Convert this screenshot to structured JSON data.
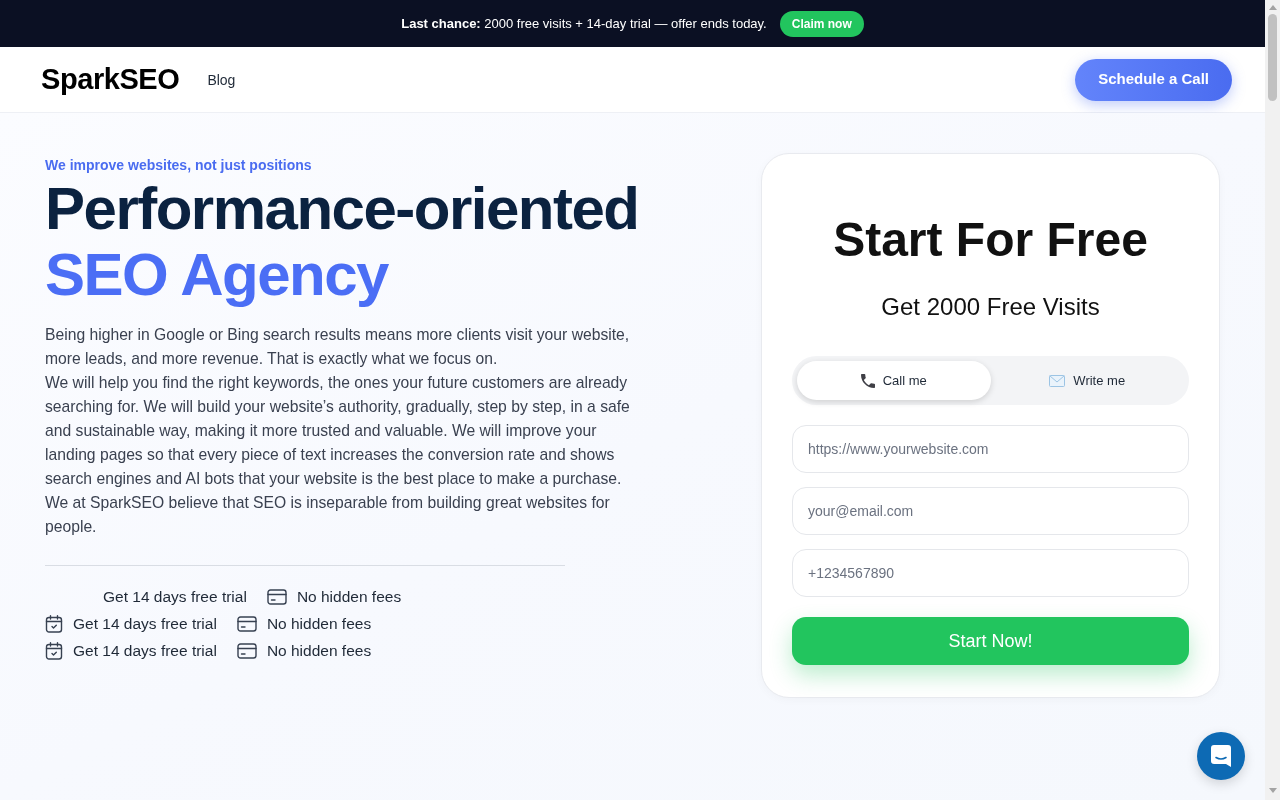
{
  "promo_banner": {
    "text": "**Last chance:** 2000 free visits + 14-day trial — offer ends today.",
    "button": "Claim now"
  },
  "nav": {
    "logo": "SparkSEO",
    "links": [
      "Blog"
    ],
    "cta": "Schedule a Call"
  },
  "hero": {
    "tagline": "We improve websites, not just positions",
    "headline": [
      {
        "text": "Performance-oriented",
        "accent": false
      },
      {
        "text": "SEO Agency",
        "accent": true
      }
    ],
    "paragraphs": [
      "Being higher in Google or Bing search results means more clients visit your website, more leads, and more revenue. That is exactly what we focus on.",
      "We will help you find the right keywords, the ones your future customers are already searching for. We will build your website’s authority, gradually, step by step, in a safe and sustainable way, making it more trusted and valuable. We will improve your landing pages so that every piece of text increases the conversion rate and shows search engines and AI bots that your website is the best place to make a purchase.",
      "We at SparkSEO believe that SEO is inseparable from building great websites for people."
    ],
    "features": [
      [
        {
          "kind": "plain",
          "text": "Get 14 days free trial"
        },
        {
          "kind": "card",
          "text": "No hidden fees"
        }
      ],
      [
        {
          "kind": "calendar",
          "text": "Get 14 days free trial"
        },
        {
          "kind": "card",
          "text": "No hidden fees"
        }
      ],
      [
        {
          "kind": "calendar",
          "text": "Get 14 days free trial"
        },
        {
          "kind": "card",
          "text": "No hidden fees"
        }
      ]
    ]
  },
  "signup_card": {
    "title": "Start For Free",
    "subtitle": "Get 2000 Free Visits",
    "tabs": [
      {
        "kind": "phone",
        "label": "Call me",
        "selected": true
      },
      {
        "kind": "envelope",
        "label": "Write me",
        "selected": false
      }
    ],
    "fields": [
      {
        "placeholder": "https://www.yourwebsite.com"
      },
      {
        "placeholder": "your@email.com"
      },
      {
        "placeholder": "+1234567890"
      }
    ],
    "submit": "Start Now!"
  }
}
